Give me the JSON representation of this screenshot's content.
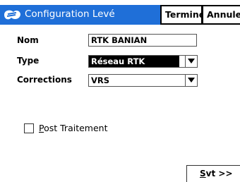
{
  "window": {
    "title": "Configuration Levé",
    "done_label": "Terminé",
    "cancel_label": "Annule"
  },
  "form": {
    "nom": {
      "label": "Nom",
      "value": "RTK BANIAN"
    },
    "type": {
      "label": "Type",
      "value": "Réseau RTK"
    },
    "corrections": {
      "label": "Corrections",
      "value": "VRS"
    },
    "post_traitement": {
      "label_first": "P",
      "label_rest": "ost Traitement",
      "checked": false
    }
  },
  "footer": {
    "next_first": "S",
    "next_rest": "vt >>"
  },
  "colors": {
    "titlebar": "#1f6fd8",
    "selected": "#000000"
  }
}
